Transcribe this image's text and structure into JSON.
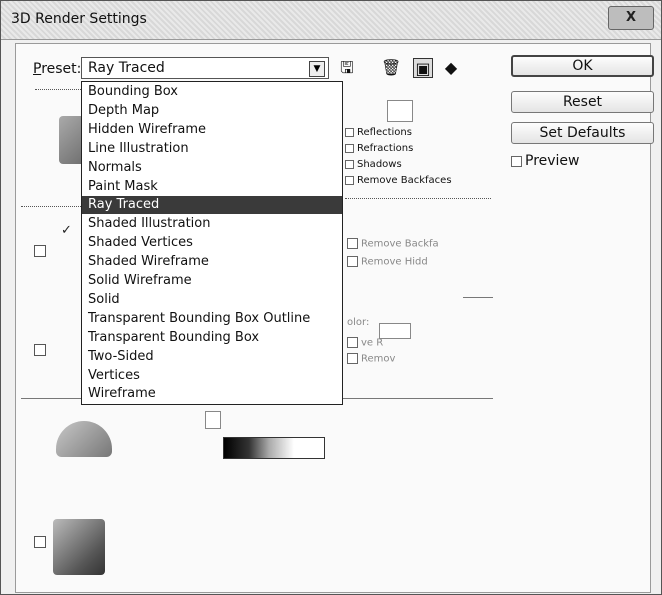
{
  "window": {
    "title": "3D Render Settings",
    "close_label": "X"
  },
  "preset": {
    "label_first": "P",
    "label_rest": "reset:",
    "value": "Ray Traced",
    "options": [
      "Bounding Box",
      "Depth Map",
      "Hidden Wireframe",
      "Line Illustration",
      "Normals",
      "Paint Mask",
      "Ray Traced",
      "Shaded Illustration",
      "Shaded Vertices",
      "Shaded Wireframe",
      "Solid Wireframe",
      "Solid",
      "Transparent Bounding Box Outline",
      "Transparent Bounding Box",
      "Two-Sided",
      "Vertices",
      "Wireframe"
    ],
    "selected_index": 6
  },
  "toolbar": {
    "icons": [
      "save-icon",
      "delete-icon",
      "render-settings-icon",
      "cube-sides-icon"
    ]
  },
  "buttons": {
    "ok": "OK",
    "reset": "Reset",
    "set_defaults": "Set Defaults",
    "preview": "Preview"
  },
  "face_options": {
    "reflections": "Reflections",
    "refractions": "Refractions",
    "shadows": "Shadows",
    "remove_backfaces": "Remove Backfaces"
  },
  "edge_options": {
    "remove_backface": "Remove Backfa",
    "remove_hidden": "Remove Hidd"
  },
  "vertex_options": {
    "label1": "olor:",
    "label2": "ve R",
    "label3": "Remov"
  },
  "colors": {
    "selection_bg": "#3a3a3a",
    "dialog_bg": "#f0f0f0"
  }
}
